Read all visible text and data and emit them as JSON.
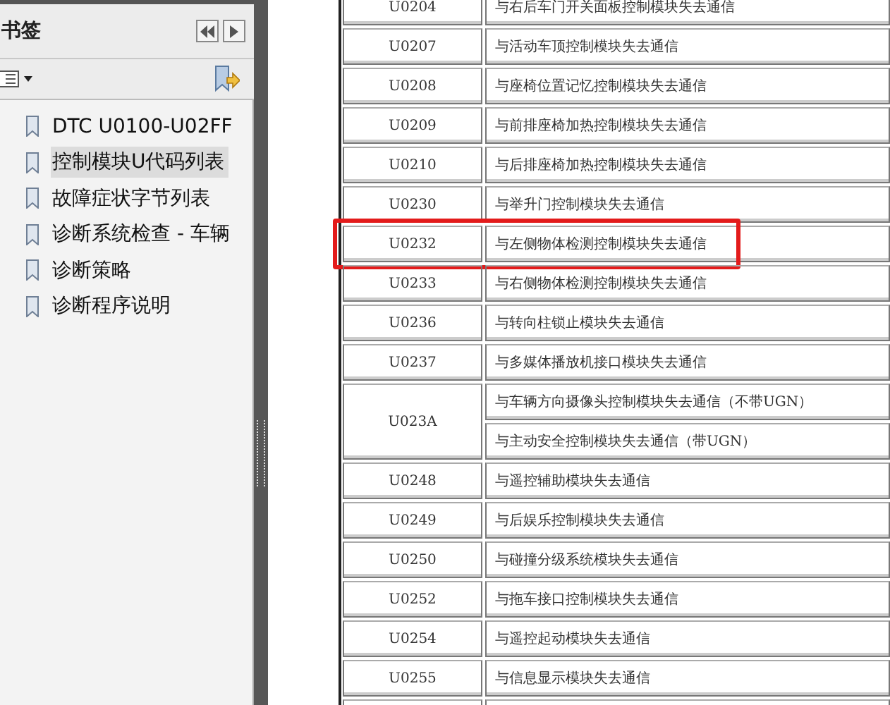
{
  "sidebar": {
    "title": "书签",
    "items": [
      {
        "label": "DTC U0100-U02FF",
        "selected": false
      },
      {
        "label": "控制模块U代码列表",
        "selected": true
      },
      {
        "label": "故障症状字节列表",
        "selected": false
      },
      {
        "label": "诊断系统检查 - 车辆",
        "selected": false
      },
      {
        "label": "诊断策略",
        "selected": false
      },
      {
        "label": "诊断程序说明",
        "selected": false
      }
    ]
  },
  "table": {
    "rows": [
      {
        "code": "U0204",
        "descriptions": [
          "与右后车门开关面板控制模块失去通信"
        ],
        "highlighted": false
      },
      {
        "code": "U0207",
        "descriptions": [
          "与活动车顶控制模块失去通信"
        ],
        "highlighted": false
      },
      {
        "code": "U0208",
        "descriptions": [
          "与座椅位置记忆控制模块失去通信"
        ],
        "highlighted": false
      },
      {
        "code": "U0209",
        "descriptions": [
          "与前排座椅加热控制模块失去通信"
        ],
        "highlighted": false
      },
      {
        "code": "U0210",
        "descriptions": [
          "与后排座椅加热控制模块失去通信"
        ],
        "highlighted": false
      },
      {
        "code": "U0230",
        "descriptions": [
          "与举升门控制模块失去通信"
        ],
        "highlighted": false
      },
      {
        "code": "U0232",
        "descriptions": [
          "与左侧物体检测控制模块失去通信"
        ],
        "highlighted": true
      },
      {
        "code": "U0233",
        "descriptions": [
          "与右侧物体检测控制模块失去通信"
        ],
        "highlighted": false
      },
      {
        "code": "U0236",
        "descriptions": [
          "与转向柱锁止模块失去通信"
        ],
        "highlighted": false
      },
      {
        "code": "U0237",
        "descriptions": [
          "与多媒体播放机接口模块失去通信"
        ],
        "highlighted": false
      },
      {
        "code": "U023A",
        "descriptions": [
          "与车辆方向摄像头控制模块失去通信（不带UGN）",
          "与主动安全控制模块失去通信（带UGN）"
        ],
        "highlighted": false
      },
      {
        "code": "U0248",
        "descriptions": [
          "与遥控辅助模块失去通信"
        ],
        "highlighted": false
      },
      {
        "code": "U0249",
        "descriptions": [
          "与后娱乐控制模块失去通信"
        ],
        "highlighted": false
      },
      {
        "code": "U0250",
        "descriptions": [
          "与碰撞分级系统模块失去通信"
        ],
        "highlighted": false
      },
      {
        "code": "U0252",
        "descriptions": [
          "与拖车接口控制模块失去通信"
        ],
        "highlighted": false
      },
      {
        "code": "U0254",
        "descriptions": [
          "与遥控起动模块失去通信"
        ],
        "highlighted": false
      },
      {
        "code": "U0255",
        "descriptions": [
          "与信息显示模块失去通信"
        ],
        "highlighted": false
      }
    ]
  }
}
